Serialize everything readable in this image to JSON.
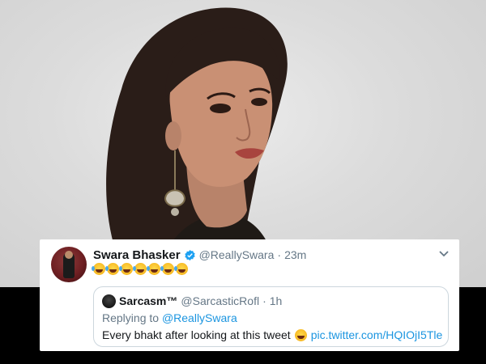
{
  "tweet": {
    "name": "Swara Bhasker",
    "handle": "@ReallySwara",
    "separator": "·",
    "time": "23m",
    "emoji_count": 7,
    "emoji": "rolling-on-floor-laughing"
  },
  "quote": {
    "name": "Sarcasm™",
    "handle": "@SarcasticRofl",
    "separator": "·",
    "time": "1h",
    "replying_prefix": "Replying to ",
    "replying_to": "@ReallySwara",
    "text": "Every bhakt after looking at this tweet",
    "link": "pic.twitter.com/HQIOjI5Tle"
  },
  "colors": {
    "verified": "#1da1f2",
    "link": "#1b95e0",
    "secondary_text": "#657786"
  }
}
